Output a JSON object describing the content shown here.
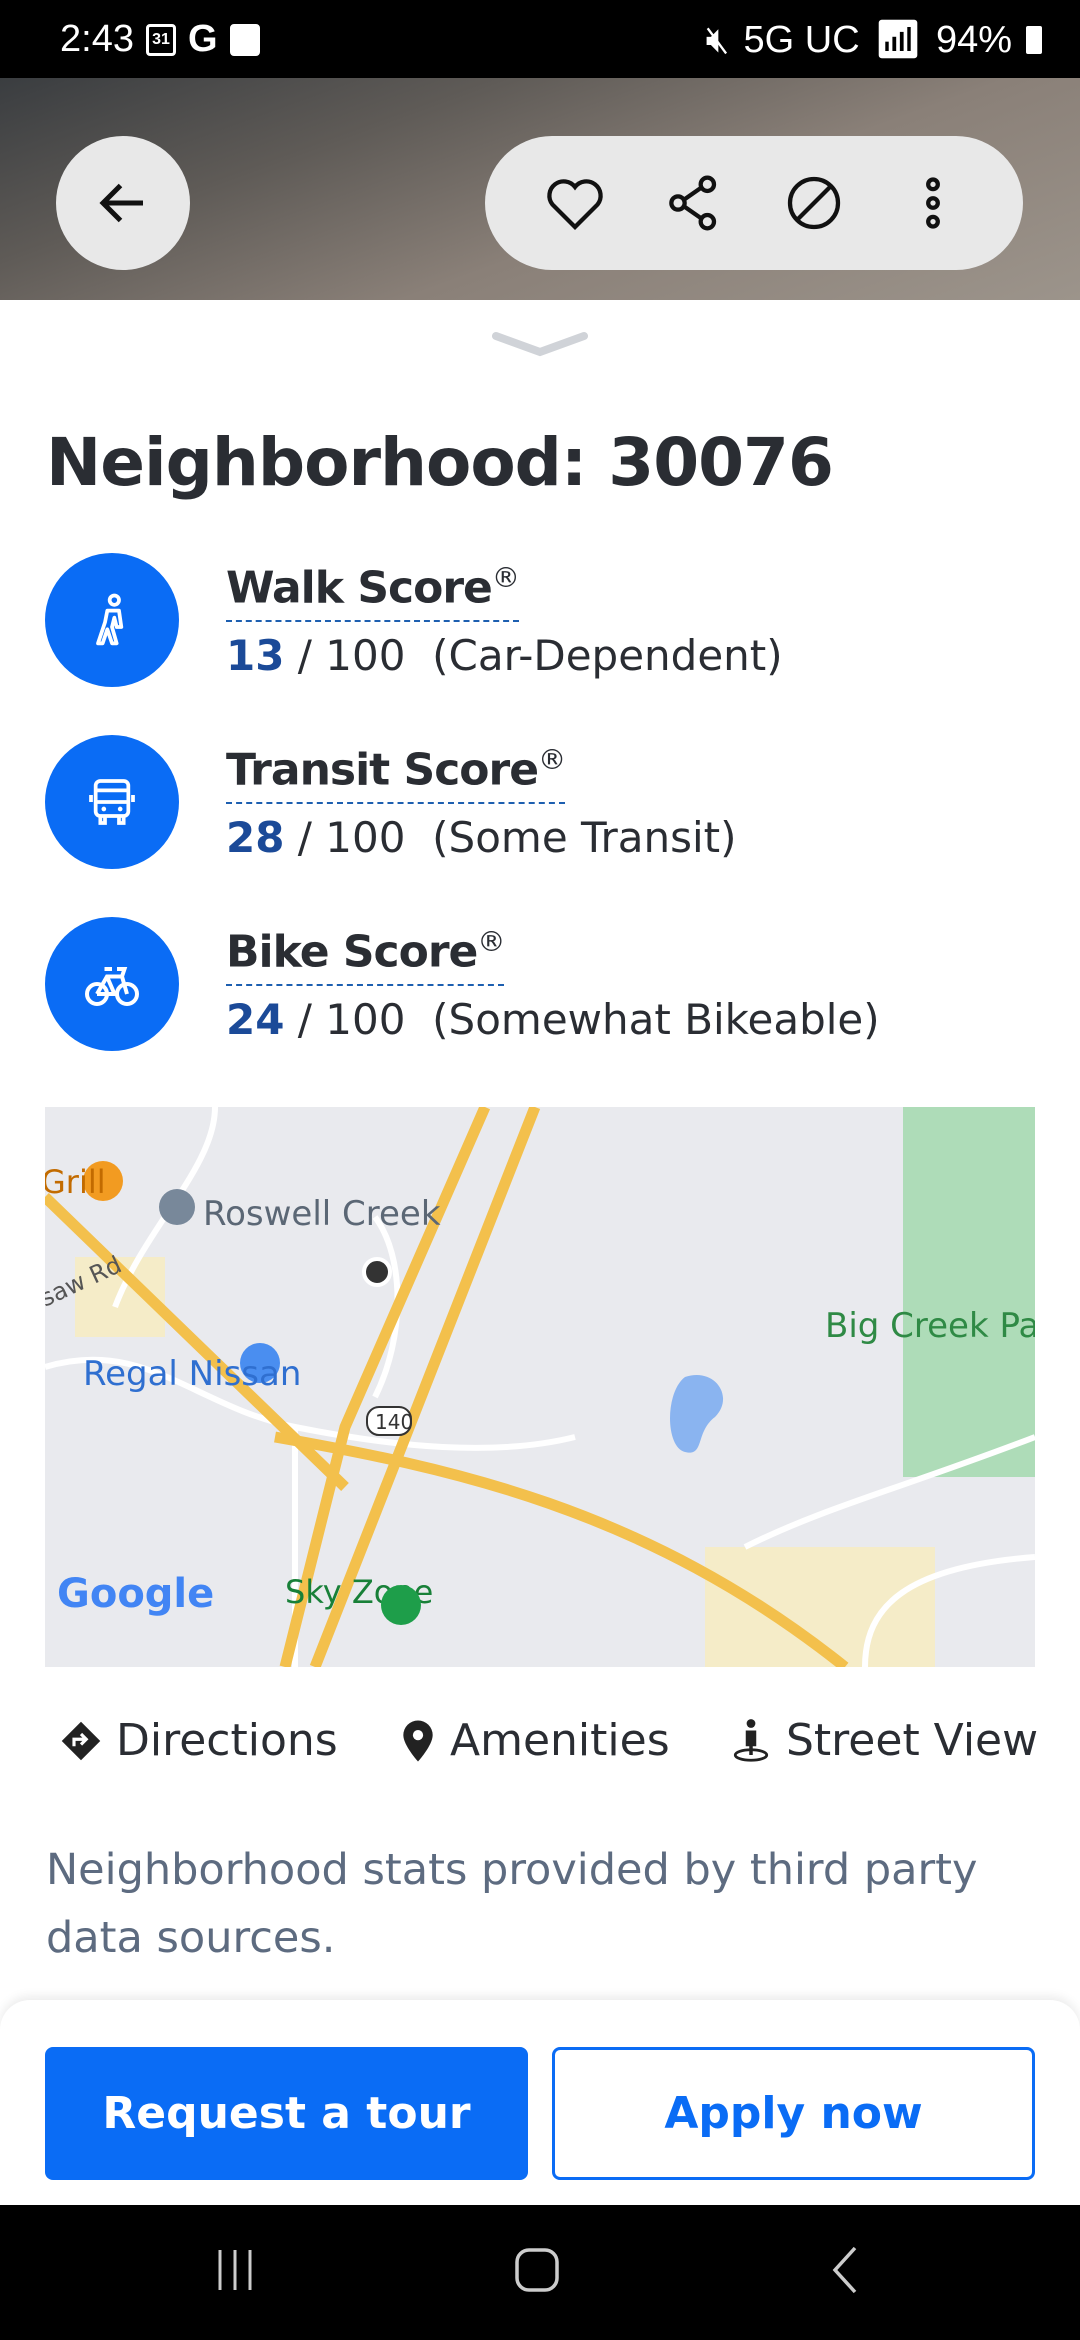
{
  "status_bar": {
    "time": "2:43",
    "calendar_day": "31",
    "network": "5G UC",
    "battery": "94%"
  },
  "header": {
    "icons": [
      "arrow-left-icon",
      "heart-icon",
      "share-icon",
      "block-icon",
      "more-vertical-icon"
    ]
  },
  "title": "Neighborhood: 30076",
  "scores": [
    {
      "label": "Walk Score",
      "mark": "®",
      "value": "13",
      "max": " / 100  (Car-Dependent)",
      "icon": "walk-icon"
    },
    {
      "label": "Transit Score",
      "mark": "®",
      "value": "28",
      "max": " / 100  (Some Transit)",
      "icon": "bus-icon"
    },
    {
      "label": "Bike Score",
      "mark": "®",
      "value": "24",
      "max": " / 100  (Somewhat Bikeable)",
      "icon": "bike-icon"
    }
  ],
  "map": {
    "labels": {
      "grill": "Grill",
      "roswell": "Roswell Creek",
      "road": "saw Rd",
      "bigcreek": "Big Creek Pa",
      "regal": "Regal Nissan",
      "route": "140",
      "skyzone": "Sky Zone",
      "google": "Google"
    }
  },
  "links": {
    "directions": "Directions",
    "amenities": "Amenities",
    "street_view": "Street View"
  },
  "disclaimer": "Neighborhood stats provided by third party data sources.",
  "footer": {
    "primary": "Request a tour",
    "secondary": "Apply now"
  },
  "colors": {
    "accent": "#0a6cf5",
    "score_value": "#1b4a98"
  }
}
